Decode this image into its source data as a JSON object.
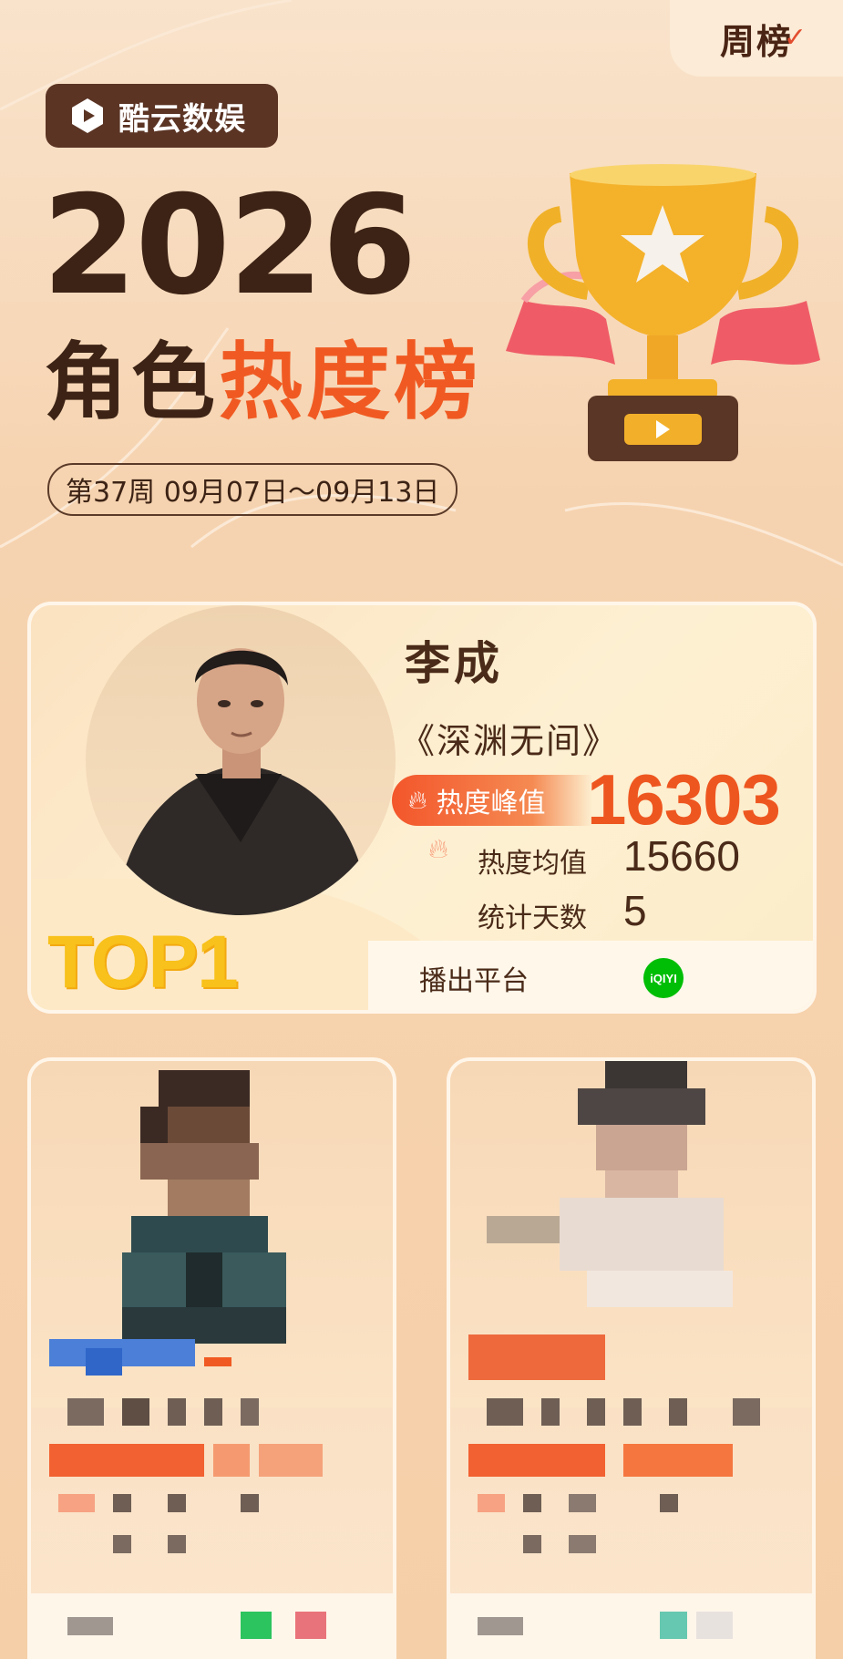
{
  "header": {
    "week_tag": "周榜",
    "brand": "酷云数娱",
    "year": "2026",
    "title_prefix": "角色",
    "title_hot": "热度榜",
    "date_range": "第37周 09月07日～09月13日"
  },
  "top1": {
    "rank_label": "TOP1",
    "character": "李成",
    "show": "《深渊无间》",
    "peak_label": "热度峰值",
    "peak_value": "16303",
    "avg_label": "热度均值",
    "avg_value": "15660",
    "days_label": "统计天数",
    "days_value": "5",
    "platform_label": "播出平台",
    "platform_icon": "iqiyi-logo",
    "platform_text": "iQIYI"
  },
  "colors": {
    "accent": "#f05a22",
    "brand_dark": "#5b3424",
    "text_dark": "#3c2315",
    "gold": "#f8c11b"
  }
}
